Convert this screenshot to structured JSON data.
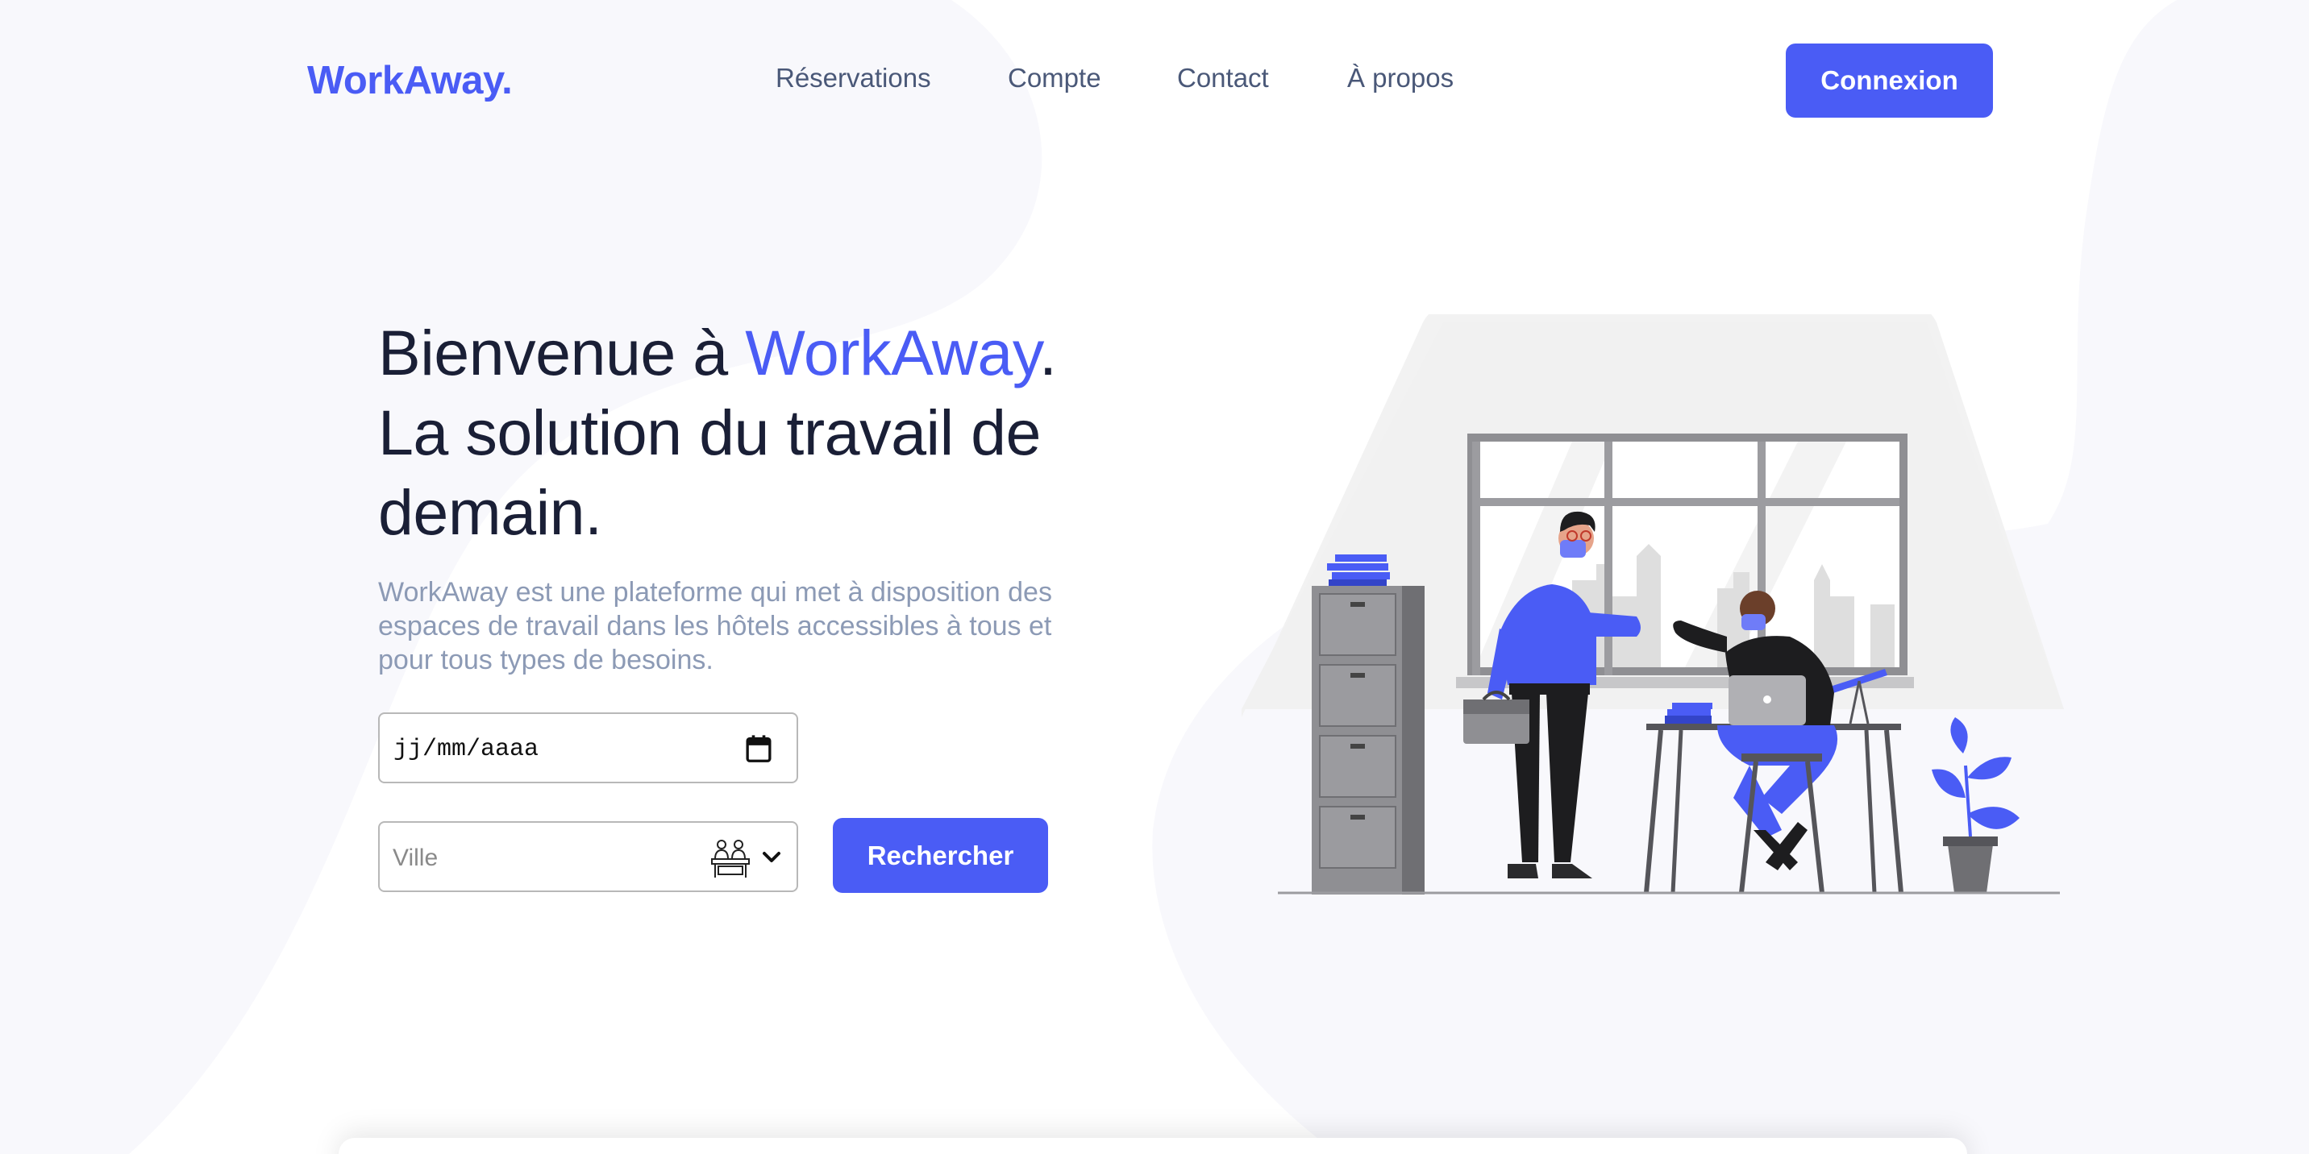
{
  "brand": {
    "logo": "WorkAway."
  },
  "nav": {
    "items": [
      {
        "label": "Réservations"
      },
      {
        "label": "Compte"
      },
      {
        "label": "Contact"
      },
      {
        "label": "À propos"
      }
    ],
    "login_label": "Connexion"
  },
  "hero": {
    "title_start": "Bienvenue à ",
    "title_accent": "WorkAway",
    "title_end": ". La solution du travail de demain.",
    "description": "WorkAway est une plateforme qui met à disposition des espaces de travail dans les hôtels accessibles à tous et pour tous types de besoins."
  },
  "search": {
    "date_value": "jj/mm/aaaa",
    "city_placeholder": "Ville",
    "button_label": "Rechercher"
  },
  "colors": {
    "accent": "#4a5cf5",
    "heading": "#1a1f36",
    "nav_text": "#4a5878",
    "muted_text": "#8c9ab5"
  },
  "icons": [
    "calendar-icon",
    "coworking-desk-icon",
    "chevron-down-icon"
  ]
}
